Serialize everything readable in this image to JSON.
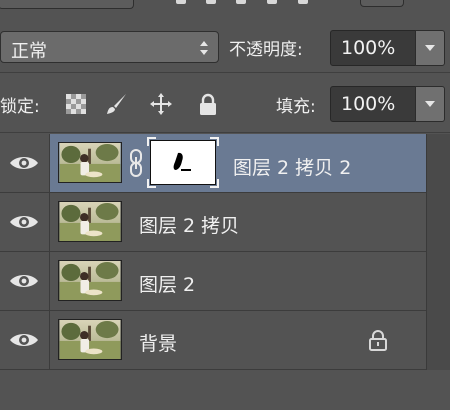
{
  "blend": {
    "mode": "正常",
    "opacity_label": "不透明度:",
    "opacity_value": "100%"
  },
  "lock": {
    "label": "锁定:",
    "fill_label": "填充:",
    "fill_value": "100%",
    "icons": [
      "transparency-lock-icon",
      "brush-lock-icon",
      "move-lock-icon",
      "padlock-icon"
    ]
  },
  "layers": [
    {
      "name": "图层 2 拷贝 2",
      "selected": true,
      "has_mask": true,
      "locked": false,
      "visible": true
    },
    {
      "name": "图层 2 拷贝",
      "selected": false,
      "has_mask": false,
      "locked": false,
      "visible": true
    },
    {
      "name": "图层 2",
      "selected": false,
      "has_mask": false,
      "locked": false,
      "visible": true
    },
    {
      "name": "背景",
      "selected": false,
      "has_mask": false,
      "locked": true,
      "visible": true
    }
  ],
  "colors": {
    "panel_bg": "#535353",
    "selected_row": "#6a7a93"
  }
}
